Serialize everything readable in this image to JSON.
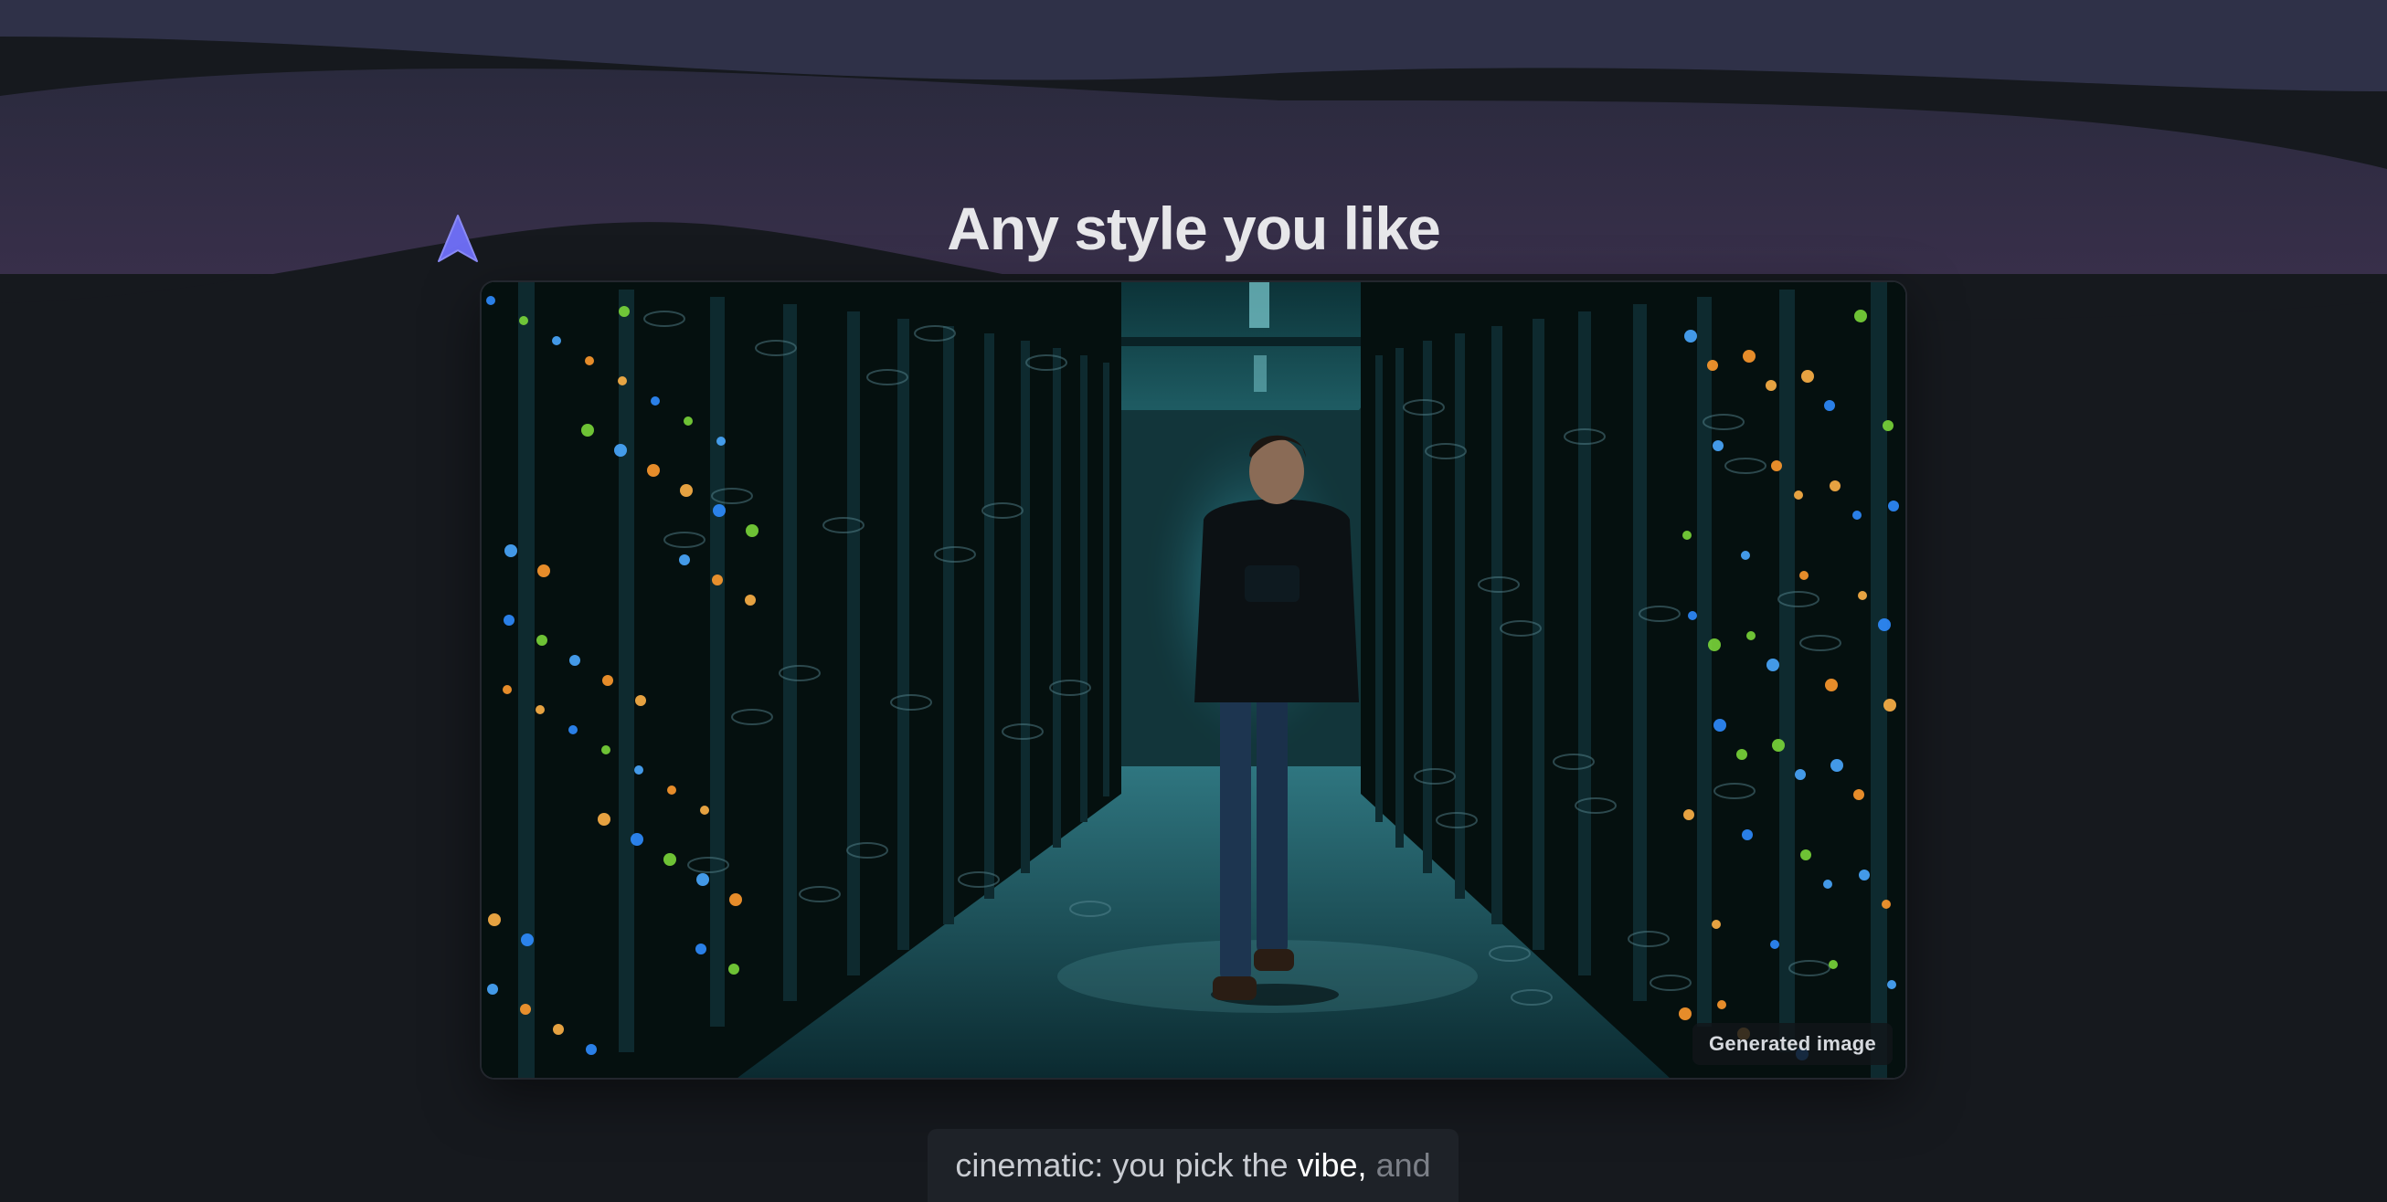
{
  "header": {
    "title": "Any style you like"
  },
  "image": {
    "badge": "Generated image"
  },
  "caption": {
    "part1": "cinematic: you pick the ",
    "highlight": "vibe,",
    "tail": "and"
  },
  "colors": {
    "accent": "#6c6cf0",
    "background": "#16191e",
    "wave": "#2c2c42"
  },
  "icons": {
    "cursor": "navigation-arrow-icon"
  }
}
